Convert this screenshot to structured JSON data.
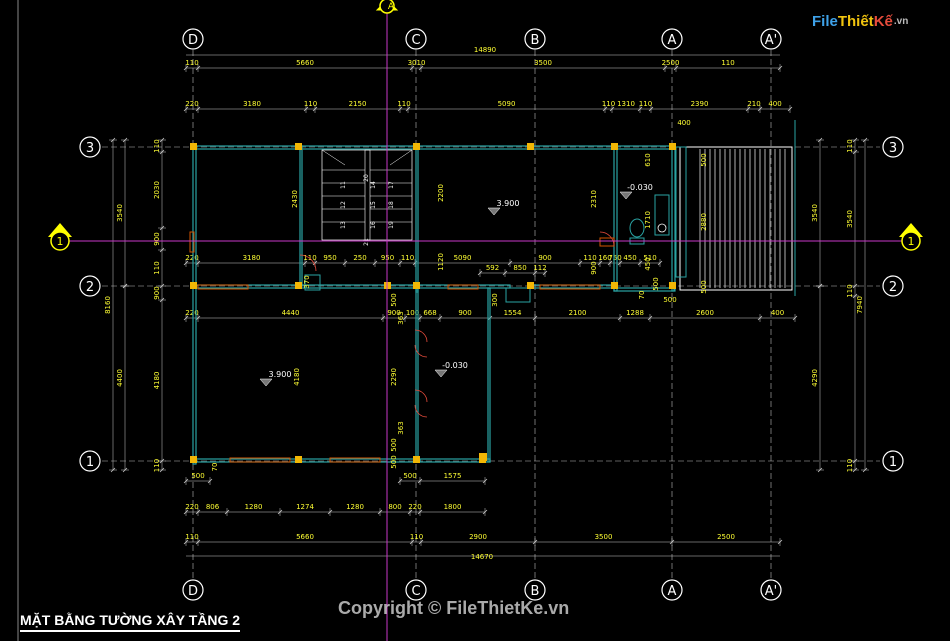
{
  "title": "MẶT BẰNG TƯỜNG XÂY TẦNG 2",
  "copyright": "Copyright © FileThietKe.vn",
  "logo": {
    "file": "File",
    "thiet": "Thiết",
    "ke": "Kế",
    "vn": ".vn"
  },
  "colors": {
    "wall": "#2aa3a3",
    "dim": "#ffff33",
    "grid": "#ffffff",
    "axis": "#c837c8",
    "column": "#f2b705",
    "text": "#ffffff"
  },
  "grid_labels": {
    "top": [
      "D",
      "C",
      "B",
      "A",
      "A'"
    ],
    "bottom": [
      "D",
      "C",
      "B",
      "A",
      "A'"
    ],
    "left": [
      "3",
      "2",
      "1"
    ],
    "right": [
      "3",
      "2",
      "1"
    ],
    "section_top": "A",
    "section_side": "1"
  },
  "dims": {
    "top_total": "14890",
    "top_row1": [
      "110",
      "5660",
      "3010",
      "3500",
      "2500",
      "110"
    ],
    "top_row2": [
      "220",
      "3180",
      "110",
      "2150",
      "110",
      "5090",
      "110",
      "1310",
      "110",
      "2390",
      "210",
      "400"
    ],
    "top_400": "400",
    "mid_row_a": [
      "220",
      "3180",
      "110",
      "950",
      "250",
      "950",
      "110",
      "5090",
      "900",
      "110",
      "160",
      "750",
      "450",
      "510"
    ],
    "mid_row_b": [
      "592",
      "850",
      "112"
    ],
    "mid_row_c": [
      "220",
      "4440",
      "900",
      "100",
      "668",
      "900",
      "1554",
      "2100",
      "1288",
      "2600",
      "400"
    ],
    "bottom_row1": [
      "500",
      "500",
      "1575"
    ],
    "bottom_row2": [
      "220",
      "806",
      "1280",
      "1274",
      "1280",
      "800",
      "220",
      "1800"
    ],
    "bottom_row3": [
      "110",
      "5660",
      "110",
      "2900",
      "3500",
      "2500"
    ],
    "bottom_total": "14670",
    "left_outer": [
      "3540",
      "8160",
      "4400"
    ],
    "left_inner": [
      "2030",
      "900",
      "110",
      "900",
      "4180"
    ],
    "left_small": [
      "110",
      "220",
      "220",
      "220",
      "110"
    ],
    "right_outer": [
      "3540",
      "7940",
      "4290"
    ],
    "right_inner": [
      "3540",
      "110"
    ],
    "right_small": [
      "110",
      "110",
      "110"
    ],
    "stair_dim": "2430",
    "room_dims": [
      "2200",
      "2310",
      "1120",
      "900",
      "2290",
      "4180"
    ],
    "toilet_dims": [
      "610",
      "500",
      "1710",
      "2880",
      "450",
      "500",
      "500",
      "70",
      "500"
    ],
    "door_dims": [
      "300",
      "363",
      "500",
      "370",
      "70",
      "363",
      "500",
      "500"
    ]
  },
  "levels": {
    "l1": "3.900",
    "l2": "3.900",
    "l3": "-0.030",
    "l4": "-0.030"
  },
  "stair_numbers": [
    "11",
    "12",
    "13",
    "14",
    "15",
    "16",
    "17",
    "18",
    "19",
    "20",
    "21"
  ]
}
